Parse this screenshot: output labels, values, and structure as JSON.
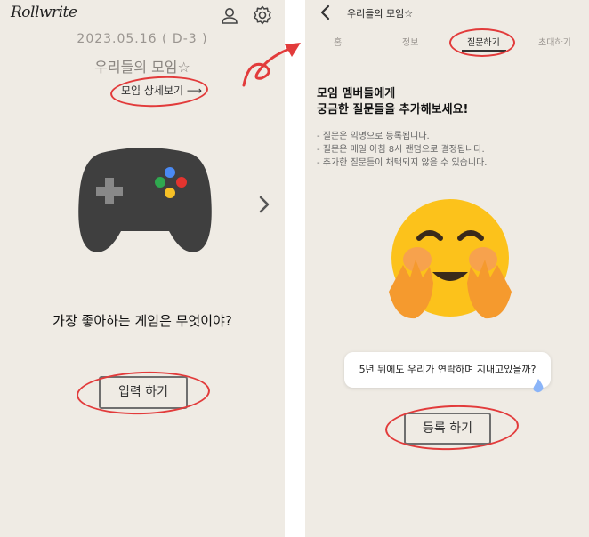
{
  "left_screen": {
    "logo": "Rollwrite",
    "profile_icon": "user-icon",
    "settings_icon": "gear-icon",
    "date": "2023.05.16 ( D-3 )",
    "meeting_title": "우리들의 모임☆",
    "detail_link": "모임 상세보기 ⟶",
    "question": "가장 좋아하는 게임은 무엇이야?",
    "input_button": "입력 하기",
    "next_icon": "chevron-right-icon",
    "illustration": "gamepad-icon"
  },
  "right_screen": {
    "back_icon": "chevron-left-icon",
    "title": "우리들의 모임☆",
    "tabs": [
      {
        "label": "홈",
        "active": false
      },
      {
        "label": "정보",
        "active": false
      },
      {
        "label": "질문하기",
        "active": true
      },
      {
        "label": "초대하기",
        "active": false
      }
    ],
    "heading_line1": "모임 멤버들에게",
    "heading_line2": "궁금한 질문들을 추가해보세요!",
    "notes": [
      "- 질문은 익명으로 등록됩니다.",
      "- 질문은 매일 아침 8시 랜덤으로 결정됩니다.",
      "- 추가한 질문들이 채택되지 않을 수 있습니다."
    ],
    "illustration": "hugging-face-emoji",
    "question_example": "5년 뒤에도 우리가 연락하며 지내고있을까?",
    "register_button": "등록 하기"
  },
  "annotation_colors": {
    "highlight": "#e23b3b",
    "background": "#efebe4"
  }
}
